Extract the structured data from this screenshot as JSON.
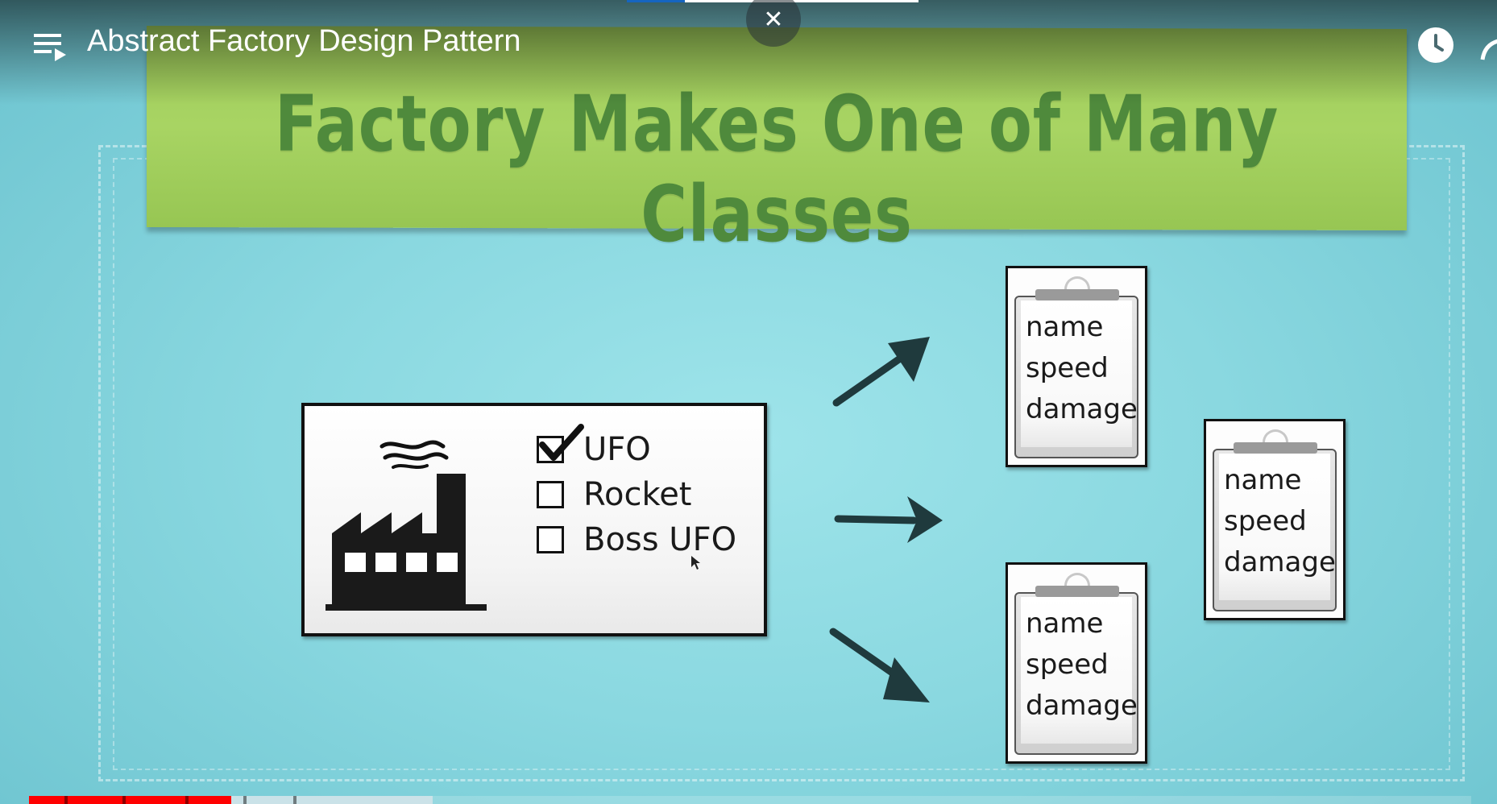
{
  "video": {
    "title": "Abstract Factory Design Pattern",
    "playback_progress_fraction": 0.14,
    "buffered_fraction": 0.28,
    "top_loading_fraction": 0.35
  },
  "slide": {
    "heading": "Factory Makes One of Many Classes",
    "factory_options": [
      {
        "label": "UFO",
        "checked": true
      },
      {
        "label": "Rocket",
        "checked": false
      },
      {
        "label": "Boss UFO",
        "checked": false
      }
    ],
    "clipboards": [
      {
        "lines": [
          "name",
          "speed",
          "damage"
        ]
      },
      {
        "lines": [
          "name",
          "speed",
          "damage"
        ]
      },
      {
        "lines": [
          "name",
          "speed",
          "damage"
        ]
      }
    ]
  },
  "icons": {
    "playlist": "playlist-icon",
    "close": "close-icon",
    "watch_later": "clock-icon",
    "share": "share-icon",
    "factory": "factory-icon"
  },
  "colors": {
    "background": "#8fdbe2",
    "banner": "#a8d463",
    "banner_text": "#4f8a3c",
    "progress_played": "#ff0000",
    "top_progress_blue": "#1565c0"
  }
}
